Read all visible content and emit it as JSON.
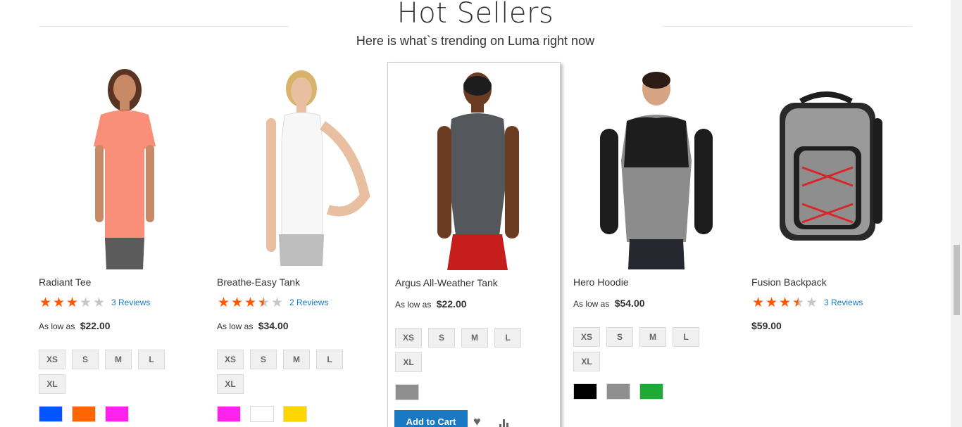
{
  "section": {
    "title": "Hot Sellers",
    "subtitle": "Here is what`s trending on Luma right now"
  },
  "products": [
    {
      "name": "Radiant Tee",
      "rating_fraction": 0.6,
      "reviews_label": "3 Reviews",
      "price_prefix": "As low as",
      "price": "$22.00",
      "sizes": [
        "XS",
        "S",
        "M",
        "L",
        "XL"
      ],
      "colors": [
        "#0055ff",
        "#ff6600",
        "#ff22ee"
      ]
    },
    {
      "name": "Breathe-Easy Tank",
      "rating_fraction": 0.7,
      "reviews_label": "2 Reviews",
      "price_prefix": "As low as",
      "price": "$34.00",
      "sizes": [
        "XS",
        "S",
        "M",
        "L",
        "XL"
      ],
      "colors": [
        "#ff22ee",
        "#ffffff",
        "#ffd500"
      ]
    },
    {
      "name": "Argus All-Weather Tank",
      "price_prefix": "As low as",
      "price": "$22.00",
      "sizes": [
        "XS",
        "S",
        "M",
        "L",
        "XL"
      ],
      "colors": [
        "#8f8f8f"
      ],
      "add_to_cart_label": "Add to Cart",
      "wishlist_icon": "heart-icon",
      "compare_icon": "bar-chart-icon"
    },
    {
      "name": "Hero Hoodie",
      "price_prefix": "As low as",
      "price": "$54.00",
      "sizes": [
        "XS",
        "S",
        "M",
        "L",
        "XL"
      ],
      "colors": [
        "#000000",
        "#8f8f8f",
        "#1eaa34"
      ]
    },
    {
      "name": "Fusion Backpack",
      "rating_fraction": 0.7,
      "reviews_label": "3 Reviews",
      "price": "$59.00"
    }
  ],
  "colors": {
    "accent": "#1979c3",
    "star": "#ff5501",
    "star_empty": "#c7c7c7"
  }
}
